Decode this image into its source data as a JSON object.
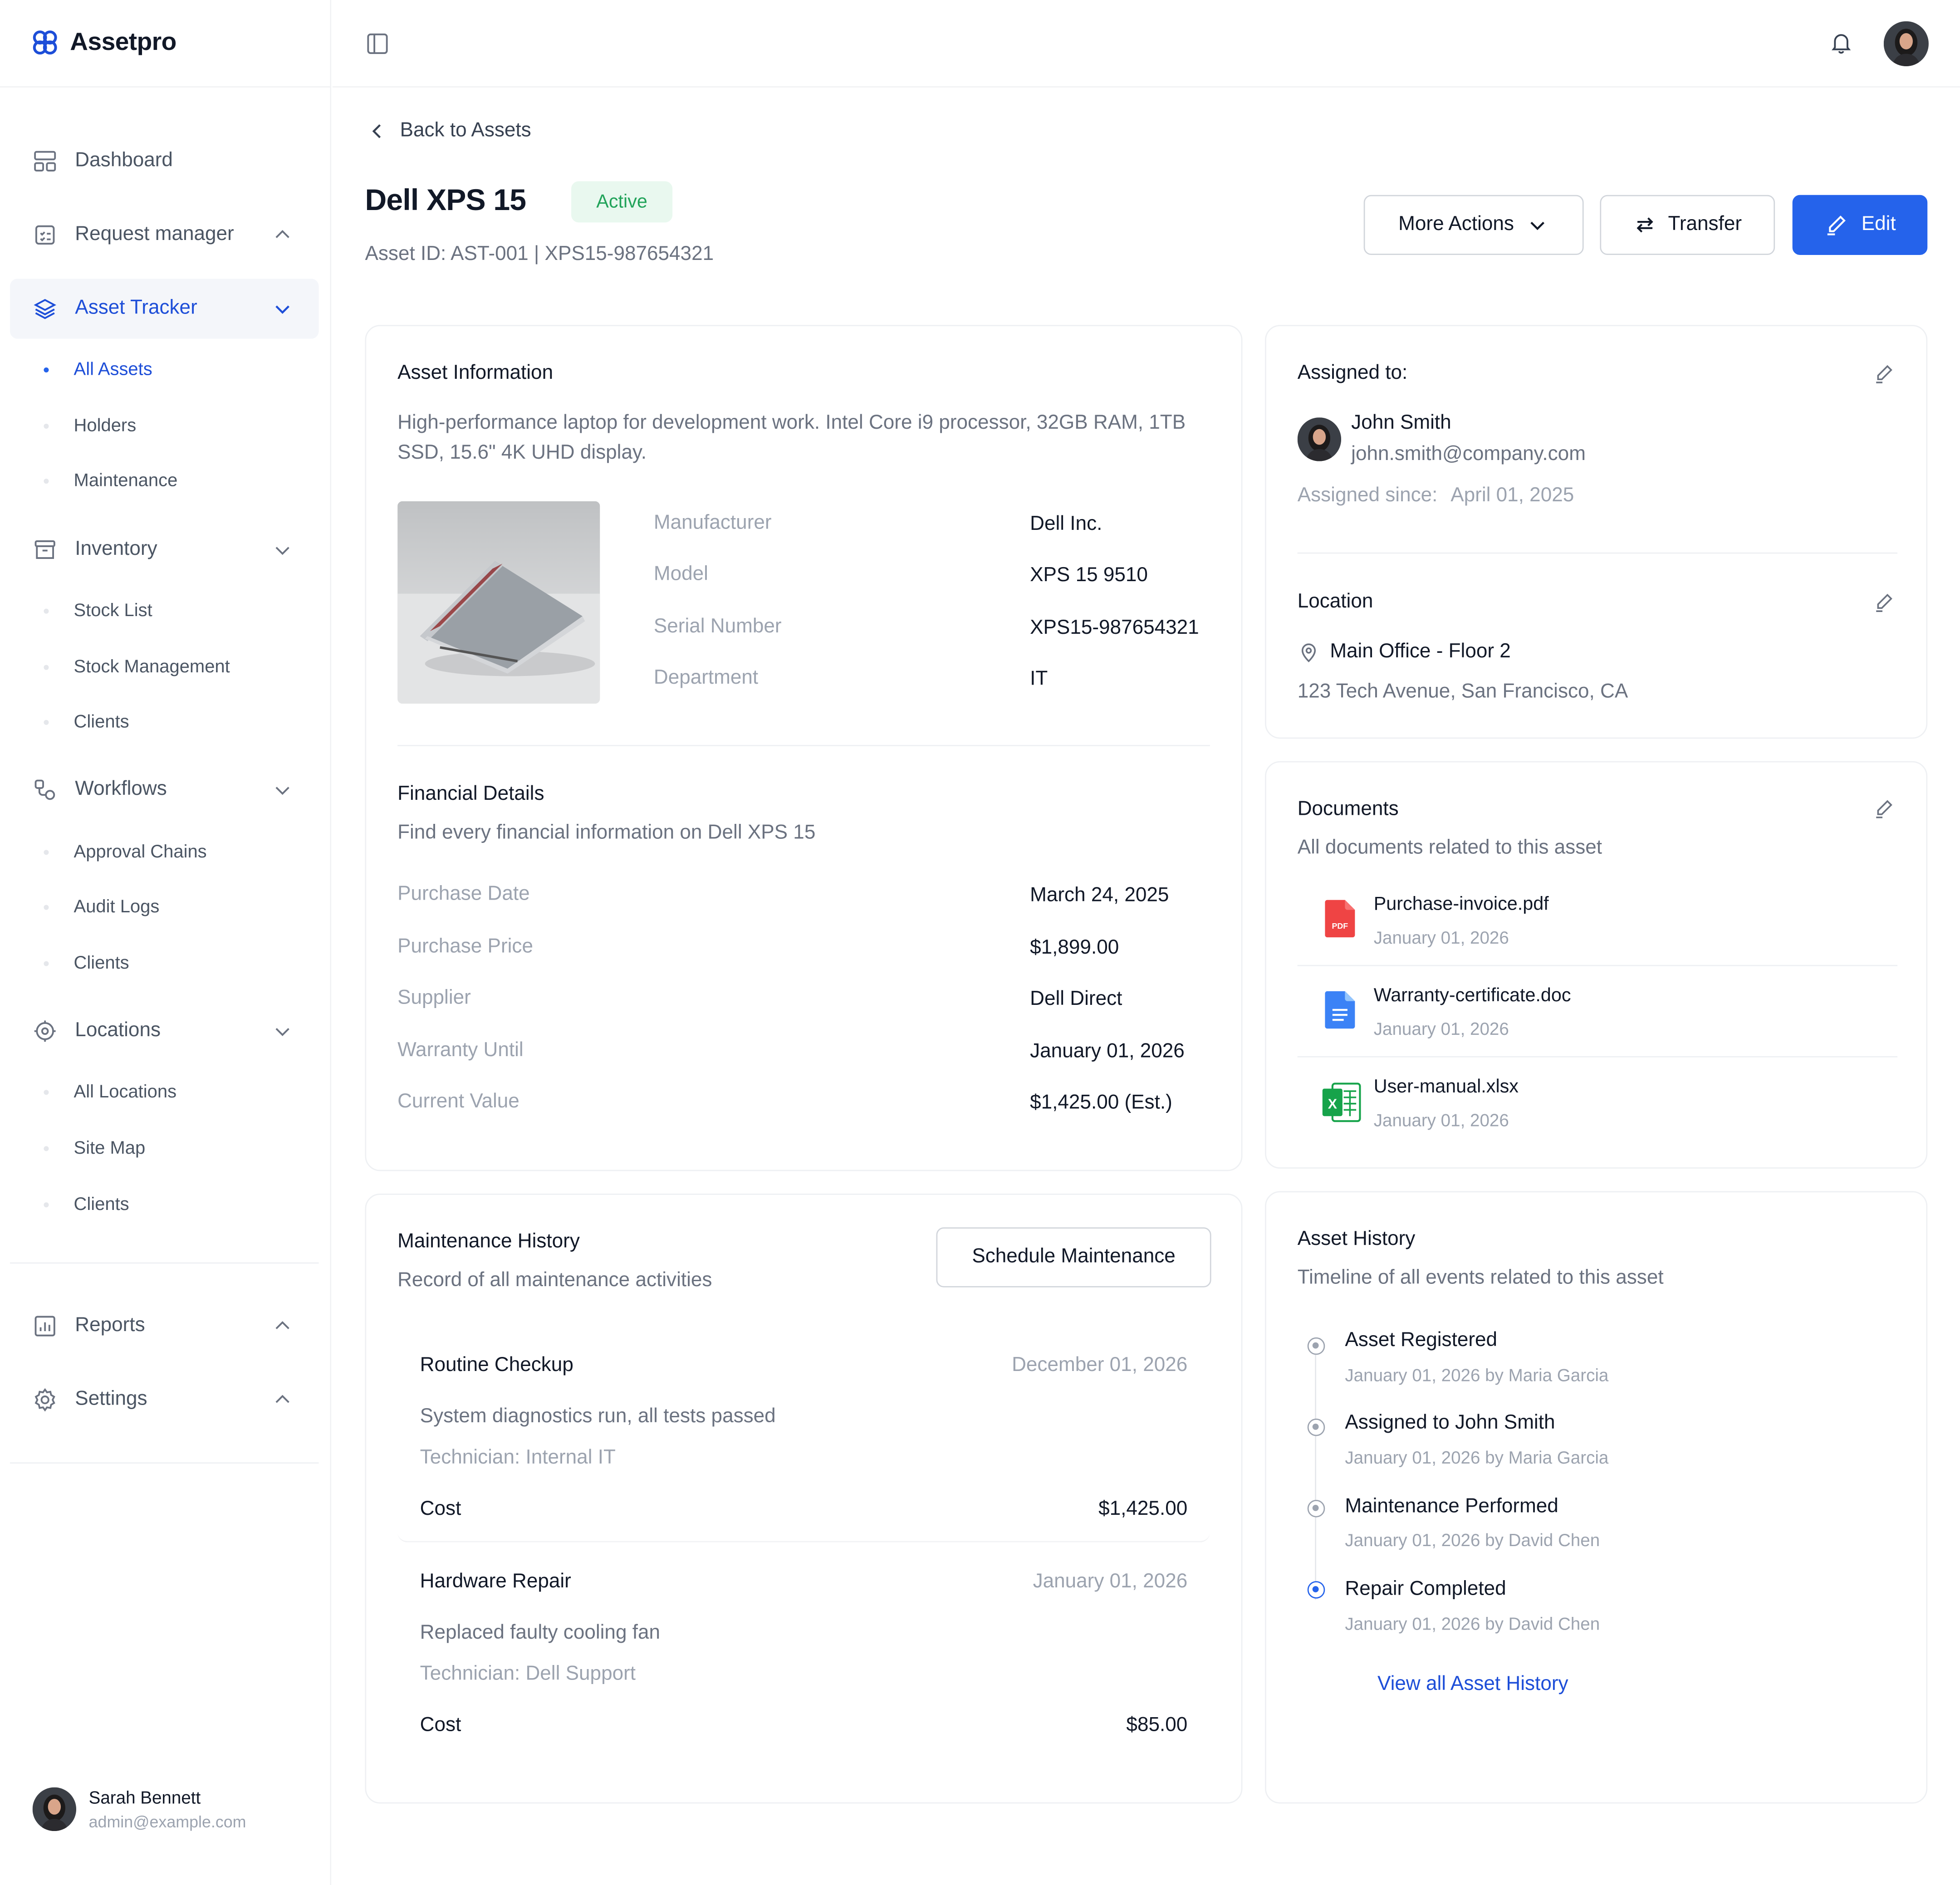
{
  "app": {
    "name": "Assetpro"
  },
  "sidebar": {
    "items": [
      {
        "label": "Dashboard"
      },
      {
        "label": "Request manager"
      },
      {
        "label": "Asset Tracker",
        "sub": [
          "All Assets",
          "Holders",
          "Maintenance"
        ]
      },
      {
        "label": "Inventory",
        "sub": [
          "Stock List",
          "Stock Management",
          "Clients"
        ]
      },
      {
        "label": "Workflows",
        "sub": [
          "Approval Chains",
          "Audit Logs",
          "Clients"
        ]
      },
      {
        "label": "Locations",
        "sub": [
          "All Locations",
          "Site Map",
          "Clients"
        ]
      },
      {
        "label": "Reports"
      },
      {
        "label": "Settings"
      }
    ],
    "user": {
      "name": "Sarah Bennett",
      "email": "admin@example.com"
    }
  },
  "header": {
    "back": "Back to Assets",
    "title": "Dell XPS 15",
    "status": "Active",
    "asset_id": "Asset ID: AST-001 | XPS15-987654321",
    "more_actions": "More Actions",
    "transfer": "Transfer",
    "edit": "Edit"
  },
  "asset_info": {
    "heading": "Asset Information",
    "description": "High-performance laptop for development work. Intel Core i9 processor, 32GB RAM, 1TB SSD, 15.6\" 4K UHD display.",
    "fields": [
      {
        "label": "Manufacturer",
        "value": "Dell Inc."
      },
      {
        "label": "Model",
        "value": "XPS 15 9510"
      },
      {
        "label": "Serial Number",
        "value": "XPS15-987654321"
      },
      {
        "label": "Department",
        "value": "IT"
      }
    ]
  },
  "financial": {
    "heading": "Financial Details",
    "subtitle": "Find every financial information on Dell XPS 15",
    "fields": [
      {
        "label": "Purchase Date",
        "value": "March 24, 2025"
      },
      {
        "label": "Purchase Price",
        "value": "$1,899.00"
      },
      {
        "label": "Supplier",
        "value": "Dell Direct"
      },
      {
        "label": "Warranty Until",
        "value": "January 01, 2026"
      },
      {
        "label": "Current Value",
        "value": "$1,425.00 (Est.)"
      }
    ]
  },
  "assigned": {
    "heading": "Assigned to:",
    "name": "John Smith",
    "email": "john.smith@company.com",
    "since_label": "Assigned since:",
    "since_value": "April 01, 2025"
  },
  "location": {
    "heading": "Location",
    "name": "Main Office - Floor 2",
    "address": "123 Tech Avenue, San Francisco, CA"
  },
  "documents": {
    "heading": "Documents",
    "subtitle": "All documents related to this asset",
    "items": [
      {
        "name": "Purchase-invoice.pdf",
        "date": "January 01, 2026",
        "icon": "pdf-file-icon",
        "badge": "PDF"
      },
      {
        "name": "Warranty-certificate.doc",
        "date": "January 01, 2026",
        "icon": "doc-file-icon"
      },
      {
        "name": "User-manual.xlsx",
        "date": "January 01, 2026",
        "icon": "excel-file-icon",
        "badge": "X"
      }
    ]
  },
  "maintenance": {
    "heading": "Maintenance History",
    "subtitle": "Record of all maintenance activities",
    "schedule_button": "Schedule Maintenance",
    "cost_label": "Cost",
    "entries": [
      {
        "title": "Routine Checkup",
        "date": "December 01, 2026",
        "desc": "System diagnostics run, all tests passed",
        "tech": "Technician: Internal IT",
        "cost": "$1,425.00"
      },
      {
        "title": "Hardware Repair",
        "date": "January 01, 2026",
        "desc": "Replaced faulty cooling fan",
        "tech": "Technician: Dell Support",
        "cost": "$85.00"
      }
    ]
  },
  "history": {
    "heading": "Asset History",
    "subtitle": "Timeline of all events related to this asset",
    "events": [
      {
        "title": "Asset Registered",
        "meta": "January 01, 2026 by Maria Garcia"
      },
      {
        "title": "Assigned to John Smith",
        "meta": "January 01, 2026 by Maria Garcia"
      },
      {
        "title": "Maintenance Performed",
        "meta": "January 01, 2026  by David Chen"
      },
      {
        "title": "Repair Completed",
        "meta": "January 01, 2026  by David Chen"
      }
    ],
    "view_all": "View all Asset History"
  },
  "colors": {
    "primary": "#2563eb",
    "active_bg": "#e9f8ef",
    "active_text": "#22a35a",
    "pdf": "#ef4444",
    "doc": "#3b82f6",
    "excel": "#16a34a"
  }
}
